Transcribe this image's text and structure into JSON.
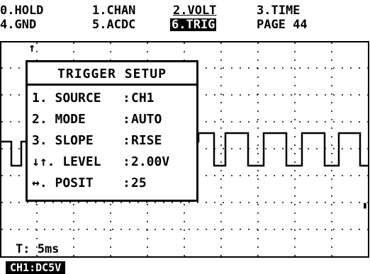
{
  "menu": {
    "items": [
      {
        "label": "0.HOLD",
        "active": false
      },
      {
        "label": "1.CHAN",
        "active": false
      },
      {
        "label": "2.VOLT",
        "active": false
      },
      {
        "label": "3.TIME",
        "active": false
      },
      {
        "label": "4.GND",
        "active": false
      },
      {
        "label": "5.ACDC",
        "active": false
      },
      {
        "label": "6.TRIG",
        "active": true
      }
    ],
    "page": "PAGE 44"
  },
  "trigger_marker": "↑",
  "dialog": {
    "title": "TRIGGER SETUP",
    "rows": [
      {
        "label": "1. SOURCE",
        "value": "CH1"
      },
      {
        "label": "2. MODE",
        "value": "AUTO"
      },
      {
        "label": "3. SLOPE",
        "value": "RISE"
      },
      {
        "label": "↓↑. LEVEL",
        "value": "2.00V"
      },
      {
        "label": "↔. POSIT",
        "value": "25"
      }
    ]
  },
  "timebase": "T: 5ms",
  "status": {
    "coupling": "CH1:DC5V"
  },
  "colors": {
    "background": "#ffffff",
    "foreground": "#000000"
  }
}
